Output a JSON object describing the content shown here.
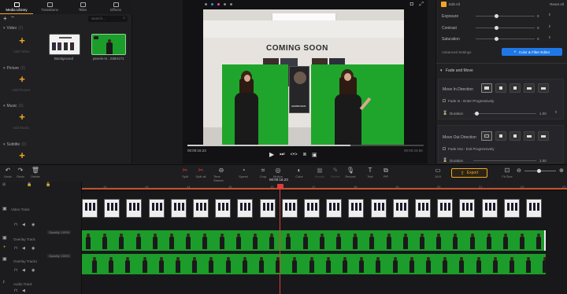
{
  "media_tabs": [
    {
      "label": "Media Library",
      "active": true,
      "icon": "media-library-icon"
    },
    {
      "label": "Transitions",
      "active": false,
      "icon": "transitions-icon"
    },
    {
      "label": "Titles",
      "active": false,
      "icon": "titles-icon"
    },
    {
      "label": "Effects",
      "active": false,
      "icon": "effects-icon"
    }
  ],
  "search_placeholder": "Search...",
  "sections": [
    {
      "title": "Video",
      "count": "(2)",
      "add_label": "Add Video"
    },
    {
      "title": "Picture",
      "count": "(0)",
      "add_label": "Add Picture"
    },
    {
      "title": "Music",
      "count": "(0)",
      "add_label": "Add Music"
    },
    {
      "title": "Subtitle",
      "count": "(0)",
      "add_label": ""
    }
  ],
  "media_items": [
    {
      "label": "Background"
    },
    {
      "label": "pexels-m...0384171"
    }
  ],
  "preview": {
    "sign_text": "COMING SOON",
    "poster_text": "GEMINI MAN",
    "time_current": "00:00:16.23",
    "time_total": "00:00:23.56",
    "progress": 0.69
  },
  "right_panel": {
    "tabs": [
      "Edit All",
      "Reset All"
    ],
    "adjust": [
      {
        "label": "Exposure",
        "value": "0"
      },
      {
        "label": "Contrast",
        "value": "0"
      },
      {
        "label": "Saturation",
        "value": "0"
      }
    ],
    "advanced_label": "Advanced Settings",
    "color_button": "Color & Filter Editor",
    "fade_title": "Fade and Move",
    "move_in_label": "Move In Direction",
    "fade_in_label": "Fade In - Enter Progressively",
    "duration_label": "Duration",
    "duration_in": "1.00",
    "move_out_label": "Move Out Direction",
    "fade_out_label": "Fade Out - Exit Progressively",
    "duration_out": "1.00"
  },
  "toolbar": {
    "left": [
      "Undo",
      "Redo",
      "Delete"
    ],
    "center": [
      "Split",
      "Split all",
      "Time Stretch",
      "Speed",
      "Crop",
      "Motion",
      "Color",
      "Mosaic",
      "Sketch",
      "Record",
      "Text",
      "PIP"
    ],
    "ratio_label": "16:9",
    "export_label": "Export",
    "fit_label": "Fit Size"
  },
  "timeline": {
    "playhead_time": "00:00:16.23",
    "ruler": [
      "12",
      "13",
      "14",
      "15",
      "16",
      "17",
      "18",
      "19",
      "20",
      "21",
      "22",
      "23"
    ],
    "tracks": [
      {
        "label": "Video Track"
      },
      {
        "label": "Overlay Track"
      },
      {
        "label": "Overlay Track1"
      },
      {
        "label": "Audio Track"
      }
    ],
    "opacity_badges": [
      "Opacity: 100%",
      "Opacity: 100%"
    ]
  },
  "colors": {
    "accent": "#f5a623",
    "primary_button": "#1f78e6",
    "chroma_green": "#1c9c2a",
    "playhead": "#e23b3b"
  }
}
